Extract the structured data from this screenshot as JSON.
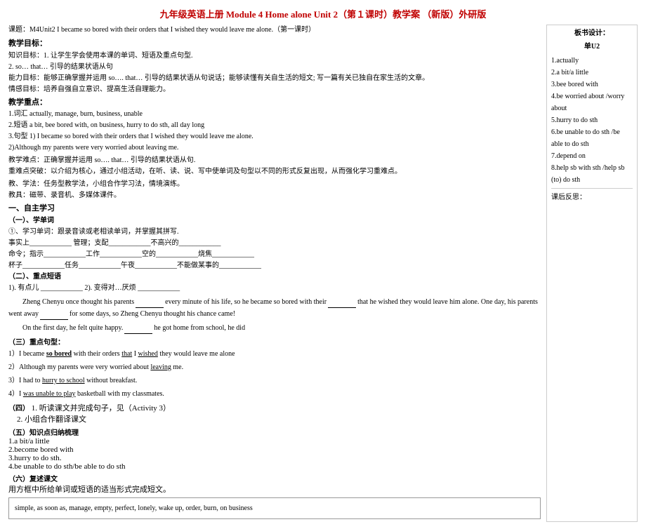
{
  "title": "九年级英语上册 Module 4 Home alone Unit 2（第１课时）教学案 （新版）外研版",
  "course_info": {
    "line1": "课题：M4Unit2 I became so bored with their orders that I wished they would leave me alone.（第一课时）",
    "section": "教学目标："
  },
  "teaching_goals": {
    "title": "教学目标：",
    "knowledge": "知识目标：1. 让学生学会使用本课的单词、短语及重点句型.",
    "knowledge2": "2. so… that… 引导的结果状语从句",
    "ability": "能力目标：能够正确掌握并运用 so…. that… 引导的结果状语从句说话；能够读懂有关自生活的短文; 写一篇有关已独自在家生活的文章。",
    "emotion": "情感目标：培养自强自立意识、提高生活自理能力。"
  },
  "key_points": {
    "title": "教学重点：",
    "items": [
      "1.词汇 actually, manage, burn, business, unable",
      "2.短语 a bit, bee bored with, on business, hurry to do sth, all day long",
      "3.句型 1) I became so bored with their orders that I wished they would leave me alone.",
      "2)Although my parents were very worried about leaving me."
    ]
  },
  "difficulty": {
    "title": "教学难点：正确掌握并运用 so…. that… 引导的结果状语从句.",
    "focus": "重难点突破：以介绍为核心，通过小组活动，在听、读、说、写中使单词及句型以不同的形式反复出现，从而强化学习重难点。"
  },
  "methods": {
    "teaching": "教、学法：任务型教学法，小组合作学习法，情境演练。",
    "tools": "教具：磁带、录音机、多媒体课件。"
  },
  "self_study": {
    "title": "一、自主学习",
    "sub1_title": "（一）、学单词",
    "sub1_content": "①、学习单词：跟录音读或老相读单词，并掌握其拼写.",
    "items": [
      "事实上____________ 管理；支配____________不高兴的____________",
      "命令；指示____________工作____________空的____________烧焦____________",
      "杯子____________任务____________午夜____________不能做某事的____________"
    ],
    "sub2_title": "（二）、重点短语",
    "phrase1": "1). 有点儿 ____________ 2). 变得对…厌烦 ____________"
  },
  "reading_text": {
    "title": "Zheng Chenyu once thought his parents",
    "blank1": "________",
    "mid1": "every minute of his life, so he became so bored with their",
    "blank2": "________",
    "mid2": "that he wished they would leave him alone. One day, his parents went away",
    "blank3": "________",
    "mid3": "for some days, so Zheng Chenyu thought his chance came!",
    "line2": "On the first day, he felt quite happy.",
    "blank4": "________",
    "mid4": "he got home from school, he did"
  },
  "part3": {
    "title": "（三）重点句型：",
    "items": [
      {
        "num": "1）",
        "text": "I became so bored with their orders that I wished they would leave me alone"
      },
      {
        "num": "2）",
        "text": "Although my parents were very worried about leaving me."
      },
      {
        "num": "3）",
        "text": "I had to hurry to school without breakfast."
      },
      {
        "num": "4）",
        "text": "I was unable to play basketball with my classmates."
      }
    ]
  },
  "part4": {
    "title": "（四）",
    "item1": "1. 听读课文并完成句子，见（Activity 3）",
    "item2": "2. 小组合作翻译课文"
  },
  "part5": {
    "title": "（五）知识点归纳梳理",
    "items": [
      "1.a bit/a little",
      "2.become bored with",
      "3.hurry to do sth.",
      "4.be unable to do sth/be able to do sth"
    ]
  },
  "part6": {
    "title": "（六）复述课文",
    "desc": "用方框中所给单词或短语的适当形式完成短文。",
    "vocab_box": "simple, as soon as, manage, empty, perfect, lonely, wake up, order, burn, on business"
  },
  "right_panel": {
    "title": "板书设计：",
    "subtitle": "单U2",
    "items": [
      "1.actually",
      "2.a bit/a little",
      "3.bee bored with",
      "4.be worried about /worry about",
      "5.hurry to do sth",
      "6.be unable to do sth /be able to do sth",
      "7.depend on",
      "8.help sb with sth /help sb (to) do sth",
      "课后反思："
    ]
  }
}
